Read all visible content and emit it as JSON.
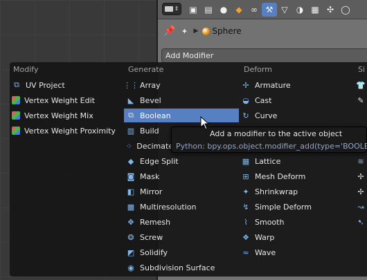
{
  "header": {
    "tabs": [
      {
        "icon": "render-icon",
        "glyph": "▣"
      },
      {
        "icon": "render-layers-icon",
        "glyph": "▤"
      },
      {
        "icon": "world-icon",
        "glyph": "●"
      },
      {
        "icon": "object-icon",
        "glyph": "◆"
      },
      {
        "icon": "constraints-icon",
        "glyph": "∞"
      },
      {
        "icon": "modifiers-wrench-icon",
        "glyph": "🔧"
      },
      {
        "icon": "data-icon",
        "glyph": "▽"
      },
      {
        "icon": "material-icon",
        "glyph": "◑"
      },
      {
        "icon": "texture-icon",
        "glyph": "▦"
      },
      {
        "icon": "particles-icon",
        "glyph": "✣"
      },
      {
        "icon": "physics-icon",
        "glyph": "◯"
      }
    ]
  },
  "context": {
    "object_name": "Sphere"
  },
  "add_modifier": {
    "label": "Add Modifier"
  },
  "menu": {
    "columns": [
      {
        "heading": "Modify",
        "items": [
          {
            "label": "UV Project",
            "icon": "uv-project-icon"
          },
          {
            "label": "Vertex Weight Edit",
            "icon": "vertex-weight-icon"
          },
          {
            "label": "Vertex Weight Mix",
            "icon": "vertex-weight-icon"
          },
          {
            "label": "Vertex Weight Proximity",
            "icon": "vertex-weight-icon"
          }
        ]
      },
      {
        "heading": "Generate",
        "items": [
          {
            "label": "Array",
            "icon": "array-icon"
          },
          {
            "label": "Bevel",
            "icon": "bevel-icon"
          },
          {
            "label": "Boolean",
            "icon": "boolean-icon"
          },
          {
            "label": "Build",
            "icon": "build-icon"
          },
          {
            "label": "Decimate",
            "icon": "decimate-icon"
          },
          {
            "label": "Edge Split",
            "icon": "edge-split-icon"
          },
          {
            "label": "Mask",
            "icon": "mask-icon"
          },
          {
            "label": "Mirror",
            "icon": "mirror-icon"
          },
          {
            "label": "Multiresolution",
            "icon": "multires-icon"
          },
          {
            "label": "Remesh",
            "icon": "remesh-icon"
          },
          {
            "label": "Screw",
            "icon": "screw-icon"
          },
          {
            "label": "Solidify",
            "icon": "solidify-icon"
          },
          {
            "label": "Subdivision Surface",
            "icon": "subsurf-icon"
          }
        ]
      },
      {
        "heading": "Deform",
        "items": [
          {
            "label": "Armature",
            "icon": "armature-icon"
          },
          {
            "label": "Cast",
            "icon": "cast-icon"
          },
          {
            "label": "Curve",
            "icon": "curve-icon"
          },
          {
            "label": "",
            "icon": ""
          },
          {
            "label": "",
            "icon": ""
          },
          {
            "label": "Lattice",
            "icon": "lattice-icon"
          },
          {
            "label": "Mesh Deform",
            "icon": "mesh-deform-icon"
          },
          {
            "label": "Shrinkwrap",
            "icon": "shrinkwrap-icon"
          },
          {
            "label": "Simple Deform",
            "icon": "simple-deform-icon"
          },
          {
            "label": "Smooth",
            "icon": "smooth-icon"
          },
          {
            "label": "Warp",
            "icon": "warp-icon"
          },
          {
            "label": "Wave",
            "icon": "wave-icon"
          }
        ]
      },
      {
        "heading": "Si"
      }
    ]
  },
  "tooltip": {
    "title": "Add a modifier to the active object",
    "python": "Python: bpy.ops.object.modifier_add(type='BOOLEAN')"
  }
}
